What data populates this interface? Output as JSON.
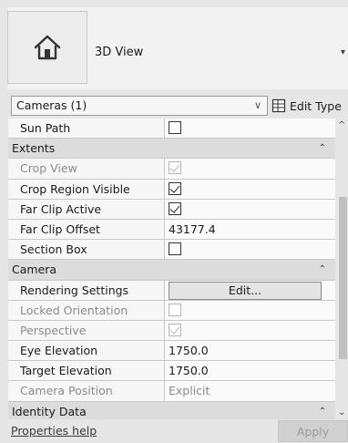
{
  "type_selector": {
    "icon": "house-icon",
    "name": "3D View"
  },
  "instance": {
    "selector_label": "Cameras (1)",
    "edit_type_label": "Edit Type"
  },
  "properties": [
    {
      "kind": "row",
      "name": "Sun Path",
      "type": "checkbox",
      "checked": false,
      "enabled": true
    },
    {
      "kind": "group",
      "name": "Extents"
    },
    {
      "kind": "row",
      "name": "Crop View",
      "type": "checkbox",
      "checked": true,
      "enabled": false
    },
    {
      "kind": "row",
      "name": "Crop Region Visible",
      "type": "checkbox",
      "checked": true,
      "enabled": true
    },
    {
      "kind": "row",
      "name": "Far Clip Active",
      "type": "checkbox",
      "checked": true,
      "enabled": true
    },
    {
      "kind": "row",
      "name": "Far Clip Offset",
      "type": "text",
      "value": "43177.4",
      "enabled": true
    },
    {
      "kind": "row",
      "name": "Section Box",
      "type": "checkbox",
      "checked": false,
      "enabled": true
    },
    {
      "kind": "group",
      "name": "Camera"
    },
    {
      "kind": "row",
      "name": "Rendering Settings",
      "type": "button",
      "value": "Edit...",
      "enabled": true
    },
    {
      "kind": "row",
      "name": "Locked Orientation",
      "type": "checkbox",
      "checked": false,
      "enabled": false
    },
    {
      "kind": "row",
      "name": "Perspective",
      "type": "checkbox",
      "checked": true,
      "enabled": false
    },
    {
      "kind": "row",
      "name": "Eye Elevation",
      "type": "text",
      "value": "1750.0",
      "enabled": true
    },
    {
      "kind": "row",
      "name": "Target Elevation",
      "type": "text",
      "value": "1750.0",
      "enabled": true
    },
    {
      "kind": "row",
      "name": "Camera Position",
      "type": "text",
      "value": "Explicit",
      "enabled": false
    },
    {
      "kind": "group",
      "name": "Identity Data"
    }
  ],
  "footer": {
    "help_label": "Properties help",
    "apply_label": "Apply"
  }
}
